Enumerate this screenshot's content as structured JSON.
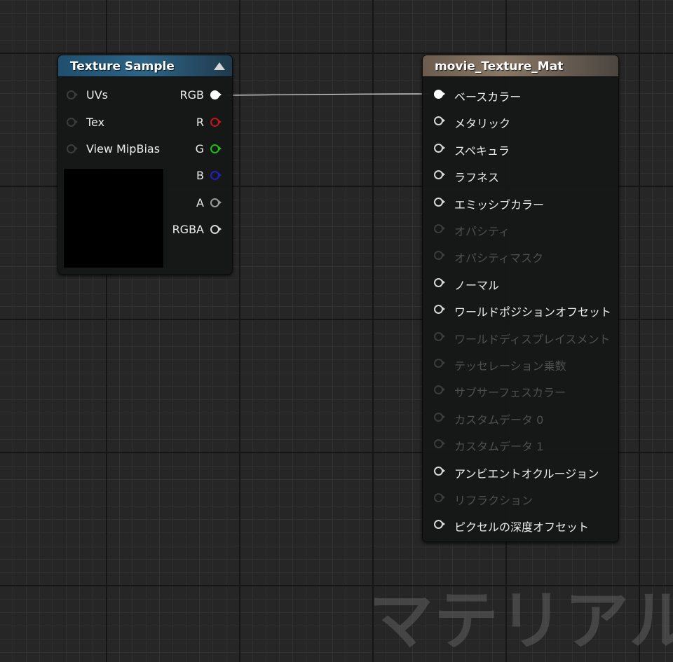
{
  "texture_node": {
    "title": "Texture Sample",
    "inputs": [
      "UVs",
      "Tex",
      "View MipBias"
    ],
    "outputs": [
      {
        "label": "RGB",
        "color": "#ffffff",
        "connected": true
      },
      {
        "label": "R",
        "color": "#c01818"
      },
      {
        "label": "G",
        "color": "#18c018"
      },
      {
        "label": "B",
        "color": "#2020c0"
      },
      {
        "label": "A",
        "color": "#9a9a9a"
      },
      {
        "label": "RGBA",
        "color": "#d6d6d6"
      }
    ]
  },
  "material_node": {
    "title": "movie_Texture_Mat",
    "pins": [
      {
        "label": "ベースカラー",
        "enabled": true,
        "connected": true
      },
      {
        "label": "メタリック",
        "enabled": true
      },
      {
        "label": "スペキュラ",
        "enabled": true
      },
      {
        "label": "ラフネス",
        "enabled": true
      },
      {
        "label": "エミッシブカラー",
        "enabled": true
      },
      {
        "label": "オパシティ",
        "enabled": false
      },
      {
        "label": "オパシティマスク",
        "enabled": false
      },
      {
        "label": "ノーマル",
        "enabled": true
      },
      {
        "label": "ワールドポジションオフセット",
        "enabled": true
      },
      {
        "label": "ワールドディスプレイスメント",
        "enabled": false
      },
      {
        "label": "テッセレーション乗数",
        "enabled": false
      },
      {
        "label": "サブサーフェスカラー",
        "enabled": false
      },
      {
        "label": "カスタムデータ 0",
        "enabled": false
      },
      {
        "label": "カスタムデータ 1",
        "enabled": false
      },
      {
        "label": "アンビエントオクルージョン",
        "enabled": true
      },
      {
        "label": "リフラクション",
        "enabled": false
      },
      {
        "label": "ピクセルの深度オフセット",
        "enabled": true
      }
    ]
  },
  "watermark": "マテリアル"
}
